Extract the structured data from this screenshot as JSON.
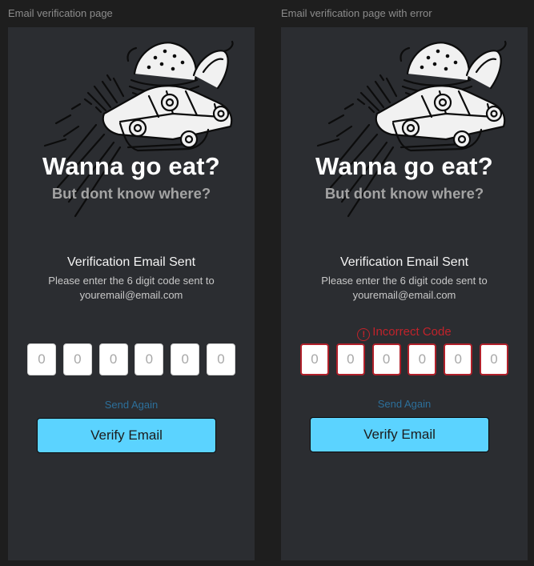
{
  "frames": [
    {
      "label": "Email verification page",
      "headline": "Wanna go eat?",
      "subheadline": "But dont know where?",
      "verification_title": "Verification Email Sent",
      "verification_text": "Please enter the 6 digit code sent to",
      "email": "youremail@email.com",
      "code_digits": [
        "0",
        "0",
        "0",
        "0",
        "0",
        "0"
      ],
      "send_again": "Send Again",
      "verify_button": "Verify Email"
    },
    {
      "label": "Email verification page with error",
      "headline": "Wanna go eat?",
      "subheadline": "But dont know where?",
      "verification_title": "Verification Email Sent",
      "verification_text": "Please enter the 6 digit code sent to",
      "email": "youremail@email.com",
      "error_icon": "!",
      "error_text": "Incorrect Code",
      "code_digits": [
        "0",
        "0",
        "0",
        "0",
        "0",
        "0"
      ],
      "send_again": "Send Again",
      "verify_button": "Verify Email"
    }
  ],
  "colors": {
    "canvas": "#1e1e1e",
    "frame_bg": "#2b2d31",
    "accent_button": "#5bd3ff",
    "error": "#c0232b",
    "link": "#2c6f9a"
  },
  "icons": {
    "illustration": "food-car-illustration-icon",
    "error": "alert-circle-icon"
  }
}
